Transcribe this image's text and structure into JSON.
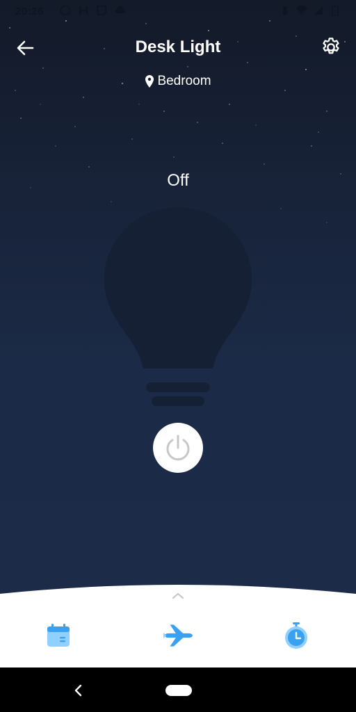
{
  "status_bar": {
    "time": "20:26",
    "left_icons": [
      "whatsapp-icon",
      "h-icon",
      "twitch-icon",
      "cloud-icon"
    ],
    "right_icons": [
      "vibrate-icon",
      "wifi-icon",
      "signal-icon",
      "battery-icon"
    ]
  },
  "header": {
    "title": "Desk Light",
    "location": "Bedroom",
    "back_icon": "arrow-left-icon",
    "settings_icon": "gear-icon"
  },
  "device": {
    "state": "Off",
    "power_on": false
  },
  "bottom_sheet": {
    "expand_icon": "chevron-up-icon",
    "tabs": [
      {
        "icon": "calendar-icon"
      },
      {
        "icon": "airplane-icon"
      },
      {
        "icon": "stopwatch-icon"
      }
    ]
  },
  "colors": {
    "accent": "#3aa0f0",
    "accent_light": "#8fd0ff",
    "background_top": "#131a28",
    "background_bottom": "#1c2c48",
    "bulb": "#152035"
  }
}
